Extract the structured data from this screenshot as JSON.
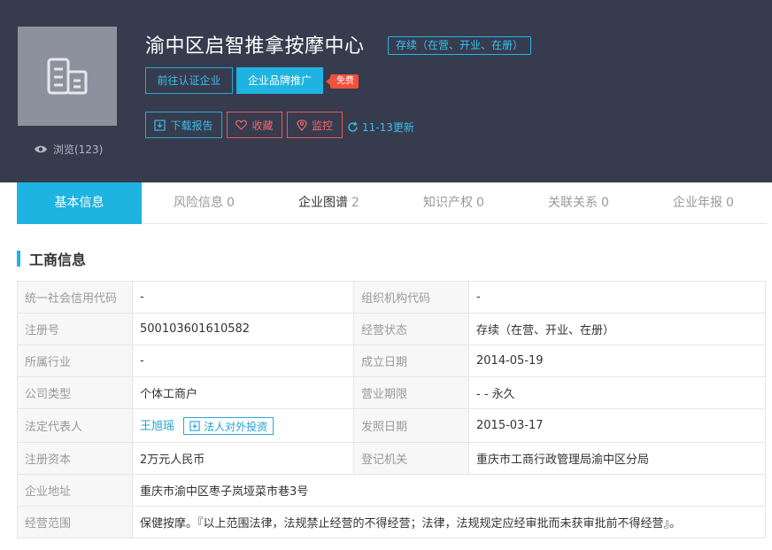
{
  "header": {
    "company_name": "渝中区启智推拿按摩中心",
    "status_tag": "存续（在营、开业、在册）",
    "views": "浏览(123)",
    "cert_button": "前往认证企业",
    "brand_button": "企业品牌推广",
    "free_tag": "免费",
    "download_button": "下载报告",
    "favorite_button": "收藏",
    "monitor_button": "监控",
    "update_text": "11-13更新"
  },
  "tabs": [
    {
      "label": "基本信息",
      "count": ""
    },
    {
      "label": "风险信息",
      "count": "0"
    },
    {
      "label": "企业图谱",
      "count": "2"
    },
    {
      "label": "知识产权",
      "count": "0"
    },
    {
      "label": "关联关系",
      "count": "0"
    },
    {
      "label": "企业年报",
      "count": "0"
    }
  ],
  "section": {
    "title": "工商信息"
  },
  "info": {
    "credit_code_label": "统一社会信用代码",
    "credit_code": "-",
    "org_code_label": "组织机构代码",
    "org_code": "-",
    "reg_no_label": "注册号",
    "reg_no": "500103601610582",
    "biz_status_label": "经营状态",
    "biz_status": "存续（在营、开业、在册）",
    "industry_label": "所属行业",
    "industry": "-",
    "founded_label": "成立日期",
    "founded": "2014-05-19",
    "company_type_label": "公司类型",
    "company_type": "个体工商户",
    "biz_term_label": "营业期限",
    "biz_term": "- - 永久",
    "legal_rep_label": "法定代表人",
    "legal_rep": "王旭瑶",
    "legal_invest_button": "法人对外投资",
    "license_date_label": "发照日期",
    "license_date": "2015-03-17",
    "capital_label": "注册资本",
    "capital": "2万元人民币",
    "authority_label": "登记机关",
    "authority": "重庆市工商行政管理局渝中区分局",
    "address_label": "企业地址",
    "address": "重庆市渝中区枣子岚垭菜市巷3号",
    "scope_label": "经营范围",
    "scope": "保健按摩。『以上范围法律，法规禁止经营的不得经营；法律，法规规定应经审批而未获审批前不得经营』。"
  },
  "colors": {
    "accent": "#1fb3e2",
    "header_bg": "#363b4e",
    "danger": "#e55a5a"
  }
}
